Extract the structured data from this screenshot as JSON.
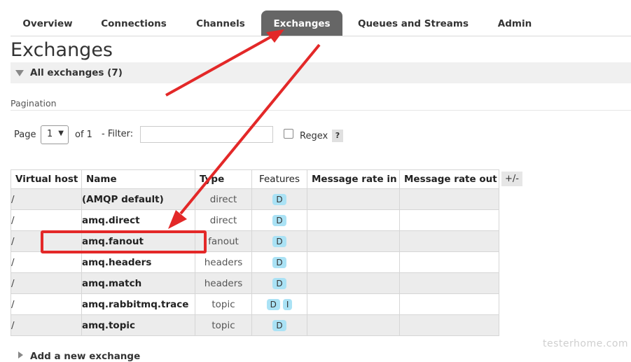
{
  "nav": {
    "tabs": [
      {
        "label": "Overview"
      },
      {
        "label": "Connections"
      },
      {
        "label": "Channels"
      },
      {
        "label": "Exchanges",
        "active": true
      },
      {
        "label": "Queues and Streams"
      },
      {
        "label": "Admin"
      }
    ]
  },
  "page": {
    "title": "Exchanges",
    "section_label": "All exchanges (7)"
  },
  "pagination": {
    "label": "Pagination",
    "page_label": "Page",
    "page_value": "1",
    "of_label": "of 1",
    "filter_label": "- Filter:",
    "filter_value": "",
    "regex_label": "Regex",
    "help_label": "?"
  },
  "table": {
    "columns": [
      "Virtual host",
      "Name",
      "Type",
      "Features",
      "Message rate in",
      "Message rate out"
    ],
    "toggle_label": "+/-",
    "rows": [
      {
        "vhost": "/",
        "name": "(AMQP default)",
        "type": "direct",
        "features": [
          "D"
        ]
      },
      {
        "vhost": "/",
        "name": "amq.direct",
        "type": "direct",
        "features": [
          "D"
        ]
      },
      {
        "vhost": "/",
        "name": "amq.fanout",
        "type": "fanout",
        "features": [
          "D"
        ]
      },
      {
        "vhost": "/",
        "name": "amq.headers",
        "type": "headers",
        "features": [
          "D"
        ]
      },
      {
        "vhost": "/",
        "name": "amq.match",
        "type": "headers",
        "features": [
          "D"
        ]
      },
      {
        "vhost": "/",
        "name": "amq.rabbitmq.trace",
        "type": "topic",
        "features": [
          "D",
          "I"
        ]
      },
      {
        "vhost": "/",
        "name": "amq.topic",
        "type": "topic",
        "features": [
          "D"
        ]
      }
    ]
  },
  "add_section": {
    "label": "Add a new exchange"
  },
  "watermark": "testerhome.com",
  "colors": {
    "active_tab": "#666666",
    "badge": "#aae2f5",
    "annotation": "#e32828",
    "row_alt": "#ececec"
  }
}
